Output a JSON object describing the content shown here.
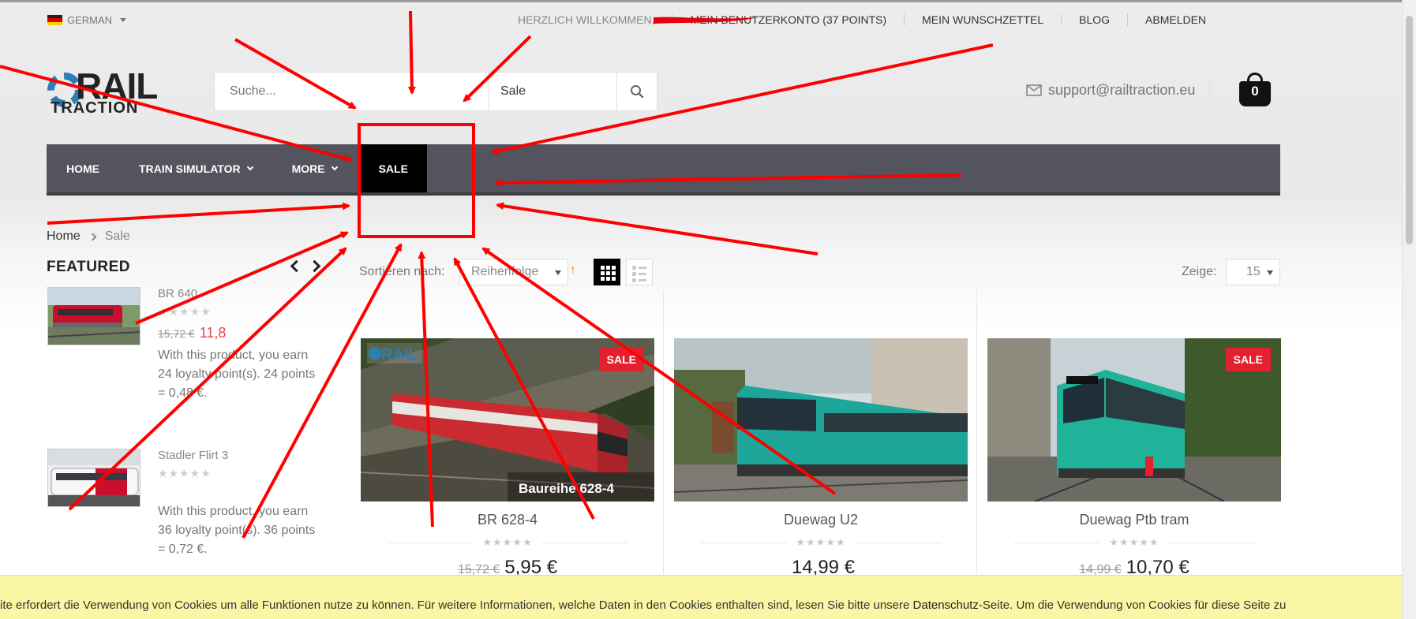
{
  "topbar": {
    "language": "GERMAN",
    "welcome": "HERZLICH WILLKOMMEN,",
    "account": "MEIN BENUTZERKONTO (37 POINTS)",
    "wishlist": "MEIN WUNSCHZETTEL",
    "blog": "BLOG",
    "logout": "ABMELDEN"
  },
  "header": {
    "logo_top": "RAIL",
    "logo_bottom": "TRACTION",
    "search_placeholder": "Suche...",
    "search_category": "Sale",
    "support_email": "support@railtraction.eu",
    "cart_count": "0"
  },
  "nav": {
    "items": [
      {
        "label": "HOME"
      },
      {
        "label": "TRAIN SIMULATOR"
      },
      {
        "label": "MORE"
      },
      {
        "label": "SALE"
      }
    ]
  },
  "breadcrumb": {
    "home": "Home",
    "current": "Sale"
  },
  "featured": {
    "title": "FEATURED",
    "items": [
      {
        "name": "BR 640",
        "old_price": "15,72 €",
        "new_price": "11,8",
        "loyalty": "With this product, you earn 24 loyalty point(s). 24 points = 0,48 €."
      },
      {
        "name": "Stadler Flirt 3",
        "loyalty": "With this product, you earn 36 loyalty point(s). 36 points = 0,72 €."
      }
    ]
  },
  "toolbar": {
    "sort_label": "Sortieren nach:",
    "sort_value": "Reihenfolge",
    "sort_direction": "↑",
    "show_label": "Zeige:",
    "show_value": "15"
  },
  "products": [
    {
      "name": "BR 628-4",
      "image_caption": "Baureihe 628-4",
      "image_logo": "RAIL",
      "badge": "SALE",
      "old_price": "15,72 €",
      "price": "5,95 €"
    },
    {
      "name": "Duewag U2",
      "price": "14,99 €"
    },
    {
      "name": "Duewag Ptb tram",
      "badge": "SALE",
      "old_price": "14,99 €",
      "price": "10,70 €"
    }
  ],
  "cookie": {
    "text_before": "ite erfordert die Verwendung von Cookies um alle Funktionen nutze zu können. Für weitere Informationen, welche Daten in den Cookies enthalten sind, lesen Sie bitte unsere ",
    "link": "Datenschutz",
    "text_after": "-Seite. Um die Verwendung von Cookies für diese Seite zu"
  },
  "colors": {
    "nav_bg": "#53545e",
    "sale_tab": "#000000",
    "badge_red": "#e3212d",
    "annotation_red": "#ff0000",
    "cookie_bg": "#fbf6a4",
    "logo_blue": "#2b7fb5"
  }
}
